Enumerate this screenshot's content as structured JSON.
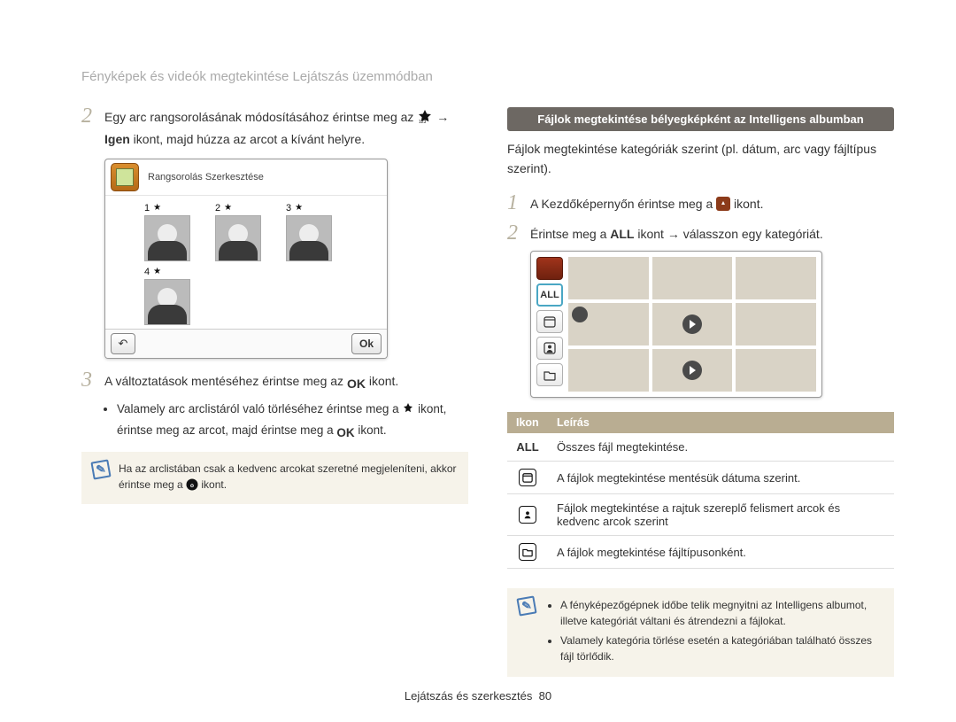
{
  "breadcrumb": "Fényképek és videók megtekintése Lejátszás üzemmódban",
  "left": {
    "step2_a": "Egy arc rangsorolásának módosításához érintse meg az",
    "step2_b_icon": "star-123-icon",
    "step2_c": " → ",
    "step2_d_bold": "Igen",
    "step2_e": " ikont, majd húzza az arcot a kívánt helyre.",
    "device": {
      "title": "Rangsorolás Szerkesztése",
      "nums": [
        "1",
        "2",
        "3",
        "4"
      ],
      "back": "↶",
      "ok": "Ok"
    },
    "step3_a": "A változtatások mentéséhez érintse meg az ",
    "step3_b_ok_icon": "ok-glyph",
    "step3_c": " ikont.",
    "bullet1_a": "Valamely arc arclistáról való törléséhez érintse meg a ",
    "bullet1_b_icon": "trash-star-icon",
    "bullet1_c": " ikont, érintse meg az arcot, majd érintse meg a ",
    "bullet1_d_icon": "ok-glyph",
    "bullet1_e": " ikont.",
    "note_a": "Ha az arclistában csak a kedvenc arcokat szeretné megjeleníteni, akkor érintse meg a ",
    "note_b_icon": "favorites-filter-icon",
    "note_c": " ikont."
  },
  "right": {
    "heading": "Fájlok megtekintése bélyegképként az Intelligens albumban",
    "intro": "Fájlok megtekintése kategóriák szerint (pl. dátum, arc vagy fájltípus szerint).",
    "step1_a": "A Kezdőképernyőn érintse meg a ",
    "step1_b_icon": "album-tile-icon",
    "step1_c": " ikont.",
    "step2_a": "Érintse meg a ",
    "step2_b_bold": "ALL",
    "step2_c": " ikont → válasszon egy kategóriát.",
    "side": {
      "album": "",
      "all": "ALL",
      "date": "date-icon",
      "face": "face-icon",
      "type": "folder-icon"
    },
    "table": {
      "h1": "Ikon",
      "h2": "Leírás",
      "rows": [
        {
          "icon": "ALL",
          "icon_kind": "text-bold",
          "desc": "Összes fájl megtekintése."
        },
        {
          "icon": "date-icon",
          "icon_kind": "box",
          "desc": "A fájlok megtekintése mentésük dátuma szerint."
        },
        {
          "icon": "face-icon",
          "icon_kind": "box",
          "desc": "Fájlok megtekintése a rajtuk szereplő felismert arcok és kedvenc arcok szerint"
        },
        {
          "icon": "folder-icon",
          "icon_kind": "box",
          "desc": "A fájlok megtekintése fájltípusonként."
        }
      ]
    },
    "note_items": [
      "A fényképezőgépnek időbe telik megnyitni az Intelligens albumot, illetve kategóriát váltani és átrendezni a fájlokat.",
      "Valamely kategória törlése esetén a kategóriában található összes fájl törlődik."
    ]
  },
  "footer": {
    "label": "Lejátszás és szerkesztés",
    "page": "80"
  }
}
